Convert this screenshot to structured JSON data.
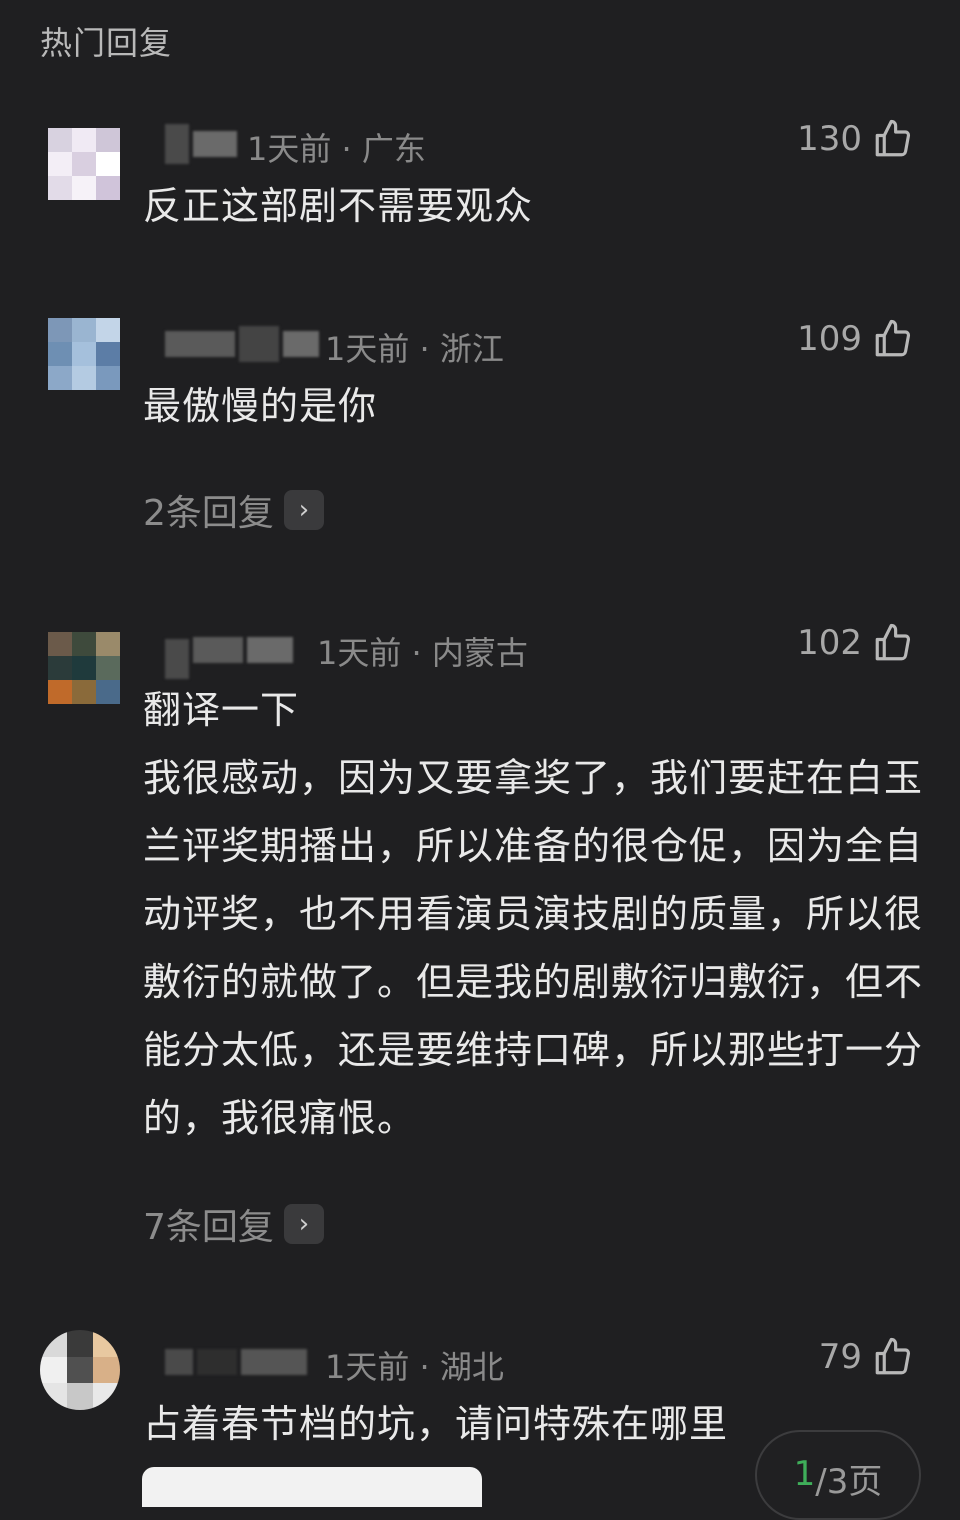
{
  "section_title": "热门回复",
  "comments": [
    {
      "time": "1天前",
      "region": "广东",
      "likes": "130",
      "text": "反正这部剧不需要观众",
      "avatar_colors": [
        "#d8d2e0",
        "#f0eaf4",
        "#cfc6d8",
        "#f3eef6",
        "#d9cfe0",
        "#ffffff",
        "#e2dbe8",
        "#f6f2f8",
        "#d0c4da"
      ]
    },
    {
      "time": "1天前",
      "region": "浙江",
      "likes": "109",
      "text": "最傲慢的是你",
      "replies": "2条回复",
      "avatar_colors": [
        "#7d97b7",
        "#9ab5d1",
        "#c3d5e8",
        "#6e8fb3",
        "#a5c0dc",
        "#5c7da6",
        "#8ca8c8",
        "#b4cbe2",
        "#7a99bd"
      ]
    },
    {
      "time": "1天前",
      "region": "内蒙古",
      "likes": "102",
      "text": "翻译一下\n我很感动，因为又要拿奖了，我们要赶在白玉兰评奖期播出，所以准备的很仓促，因为全自动评奖，也不用看演员演技剧的质量，所以很敷衍的就做了。但是我的剧敷衍归敷衍，但不能分太低，还是要维持口碑，所以那些打一分的，我很痛恨。",
      "replies": "7条回复",
      "avatar_colors": [
        "#6b5a4a",
        "#3e4a3c",
        "#9a8a6a",
        "#2b3b3a",
        "#1f3a3c",
        "#5a6a5c",
        "#c06a2a",
        "#8a6a3a",
        "#4a6a8a"
      ]
    },
    {
      "time": "1天前",
      "region": "湖北",
      "likes": "79",
      "text": "占着春节档的坑，请问特殊在哪里",
      "avatar_colors": [
        "#d9d9d9",
        "#3a3a3a",
        "#e8c8a0",
        "#f0f0f0",
        "#505050",
        "#d8b088",
        "#e5e5e5",
        "#c8c8c8",
        "#e9e9e9"
      ]
    }
  ],
  "separator": "·",
  "pager": {
    "current": "1",
    "total": "/3页"
  }
}
